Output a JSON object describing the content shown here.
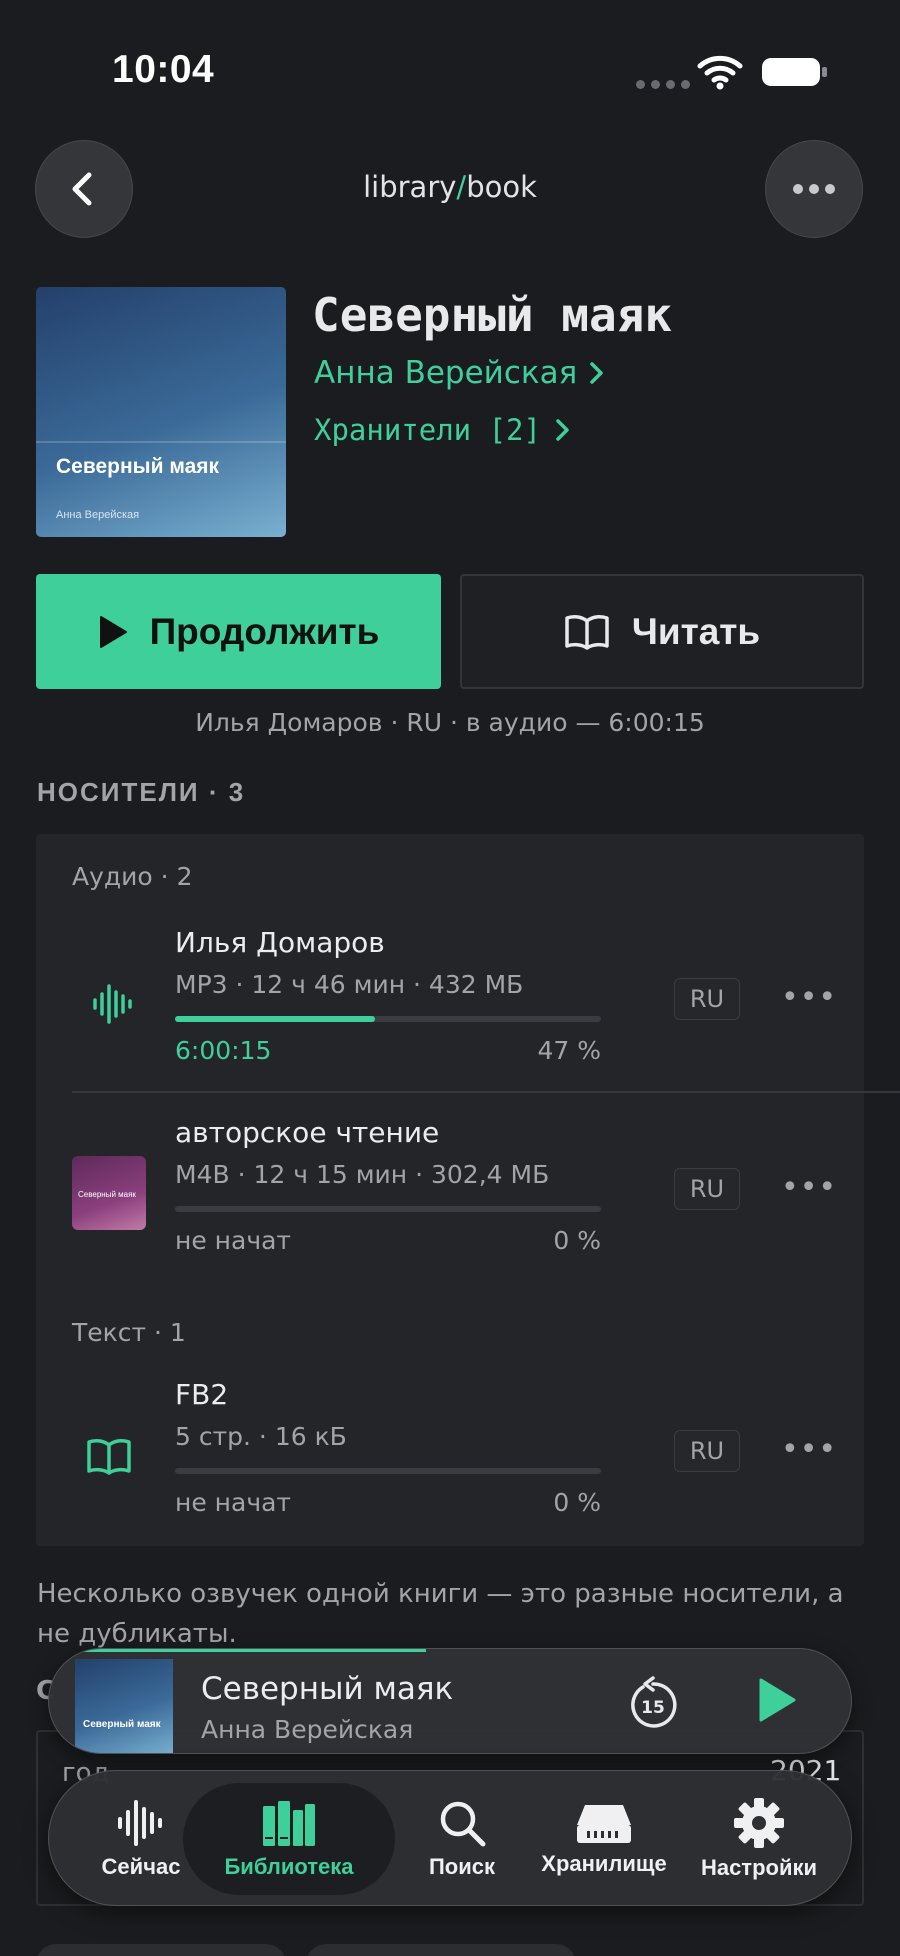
{
  "status_bar": {
    "time": "10:04"
  },
  "nav": {
    "breadcrumb_left": "library",
    "breadcrumb_sep": "/",
    "breadcrumb_right": "book"
  },
  "book": {
    "cover_title": "Северный маяк",
    "cover_author": "Анна Верейская",
    "title": "Северный маяк",
    "author": "Анна Верейская",
    "keepers": "Хранители [2]"
  },
  "actions": {
    "continue_label": "Продолжить",
    "read_label": "Читать",
    "resume_info": "Илья Домаров · RU · в аудио — 6:00:15"
  },
  "media": {
    "section_title": "НОСИТЕЛИ · 3",
    "groups": [
      {
        "label": "Аудио · 2",
        "items": [
          {
            "title": "Илья Домаров",
            "meta": "MP3 · 12 ч 46 мин · 432 МБ",
            "time": "6:00:15",
            "percent": "47 %",
            "progress": 0.47,
            "lang": "RU",
            "icon": "waveform-icon"
          },
          {
            "title": "авторское чтение",
            "meta": "M4B · 12 ч 15 мин · 302,4 МБ",
            "time": "не начат",
            "percent": "0 %",
            "progress": 0,
            "lang": "RU",
            "icon": "mini-cover",
            "mini_cover_text": "Северный маяк"
          }
        ]
      },
      {
        "label": "Текст · 1",
        "items": [
          {
            "title": "FB2",
            "meta": "5 стр. · 16 кБ",
            "time": "не начат",
            "percent": "0 %",
            "progress": 0,
            "lang": "RU",
            "icon": "book-open-icon"
          }
        ]
      }
    ],
    "more_glyph": "•••",
    "footnote": "Несколько озвучек одной книги — это разные носители, а не дубликаты."
  },
  "details_peek": {
    "section_letter": "С",
    "year_label": "год",
    "year_value": "2021"
  },
  "mini_player": {
    "title": "Северный маяк",
    "author": "Анна Верейская",
    "cover_text": "Северный маяк",
    "skip_seconds": "15",
    "progress": 0.47
  },
  "tabs": [
    {
      "label": "Сейчас",
      "icon": "waveform-icon",
      "active": false
    },
    {
      "label": "Библиотека",
      "icon": "books-icon",
      "active": true
    },
    {
      "label": "Поиск",
      "icon": "search-icon",
      "active": false
    },
    {
      "label": "Хранилище",
      "icon": "storage-icon",
      "active": false
    },
    {
      "label": "Настройки",
      "icon": "gear-icon",
      "active": false
    }
  ],
  "colors": {
    "accent": "#3fcf9b",
    "background": "#1b1c1f",
    "card": "#232529",
    "muted": "#a3a4a8"
  }
}
